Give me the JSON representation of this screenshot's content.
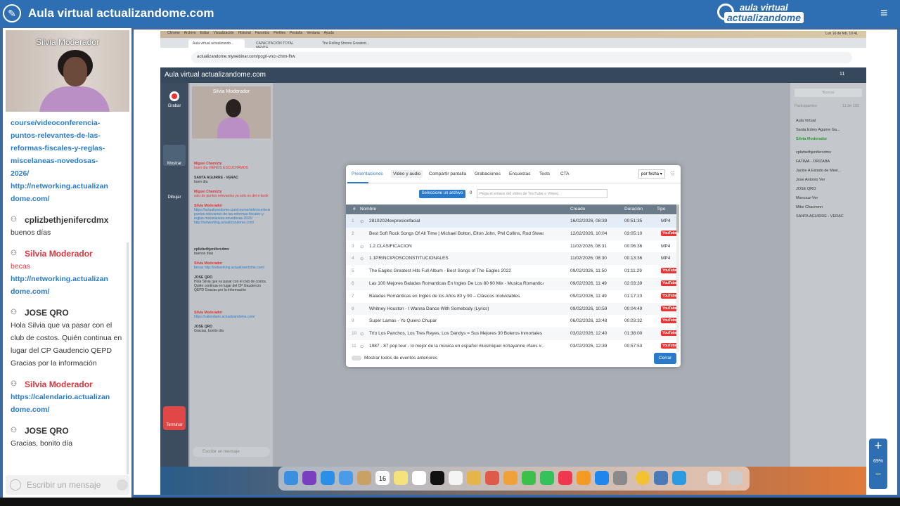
{
  "app": {
    "title": "Aula virtual actualizandome.com",
    "logo_top": "aula virtual",
    "logo_bottom": "actualizandome",
    "menu_icon": "≡"
  },
  "left_video": {
    "name": "Silvia Moderador"
  },
  "left_chat": {
    "link1_lines": [
      "course/videoconferencia-",
      "puntos-relevantes-de-las-",
      "reformas-fiscales-y-reglas-",
      "miscelaneas-novedosas-",
      "2026/"
    ],
    "link2_lines": [
      "http://networking.actualizan",
      "dome.com/"
    ],
    "messages": [
      {
        "author": "cplizbethjenifercdmx",
        "lines": [
          "buenos días"
        ],
        "color": "dark"
      },
      {
        "author": "Silvia Moderador",
        "lines": [
          "becas"
        ],
        "links": [
          "http://networking.actualizan",
          "dome.com/"
        ],
        "color": "red"
      },
      {
        "author": "JOSE QRO",
        "lines": [
          "Hola Silvia que va pasar con el",
          "club de costos. Quién continua en",
          "lugar del CP Gaudencio QEPD",
          "Gracias por la información"
        ],
        "color": "dark"
      },
      {
        "author": "Silvia Moderador",
        "lines": [],
        "links": [
          "https://calendario.actualizan",
          "dome.com/"
        ],
        "color": "red"
      },
      {
        "author": "JOSE QRO",
        "lines": [
          "Gracias, bonito día"
        ],
        "color": "dark"
      }
    ],
    "input_placeholder": "Escribir un mensaje"
  },
  "shared_screen": {
    "mac_menu": [
      "Chrome",
      "Archivo",
      "Editar",
      "Visualización",
      "Historial",
      "Favoritos",
      "Perfiles",
      "Pestaña",
      "Ventana",
      "Ayuda"
    ],
    "mac_status": "Lun 16 de feb. 10:41",
    "tabs": [
      "Aula virtual actualizando...",
      "CAPACITACIÓN TOTAL MENTE...",
      "The Rolling Stones Greatest..."
    ],
    "url": "actualizandome.mywebinar.com/pcgri-vncr-zhtm-fhw",
    "app_title": "Aula virtual actualizandome.com",
    "left_tools": [
      "Grabar",
      "Mostrar",
      "Dibujar",
      "Terminar"
    ],
    "mini_video_name": "Silvia Moderador",
    "mini_chat": [
      {
        "author": "Miguel Chamizty",
        "text": "buen día\nVIENOS ESCUCHAMOS",
        "color": "red"
      },
      {
        "author": "SANTA AGUIRRE - VERAC",
        "text": "buen día",
        "color": "dark"
      },
      {
        "author": "Miguel Chamizty",
        "text": "solo de puntos relevantes ya solo es del\ne-book",
        "color": "red"
      },
      {
        "author": "Silvia Moderador",
        "text": "https://actualizandome.com/course/videoconferencia-puntos-relevantes-de-las-reformas-fiscales-y-reglas-miscelaneas-novedosas-2026/\nhttp://networking.actualizandome.com/",
        "color": "blue"
      },
      {
        "author": "cplizbethjenifercdmx",
        "text": "buenos días",
        "color": "dark"
      },
      {
        "author": "Silvia Moderador",
        "text": "becas\nhttp://networking.actualizandome.com/",
        "color": "blue"
      },
      {
        "author": "JOSE QRO",
        "text": "Hola Silvia que va pasar con el club de costos. Quién continua en lugar del CP Gaudencio QEPD\nGracias por la información",
        "color": "dark"
      },
      {
        "author": "Silvia Moderador",
        "text": "https://calendario.actualizandome.com/",
        "color": "blue"
      },
      {
        "author": "JOSE QRO",
        "text": "Gracias, bonito día",
        "color": "dark"
      }
    ],
    "mini_input": "Escribir un mensaje",
    "participants": {
      "search": "Buscar",
      "label": "Participantes",
      "count": "11 de 100",
      "items": [
        "Aula Virtual",
        "Santa Edrey Aguirre Ga...",
        "Silvia Moderador",
        "cplizbethjenifercdmx",
        "FATIMA - ORIZABA",
        "Jackie A Estado de Mexi...",
        "Jose Antonio Ver",
        "JOSE QRO",
        "Mancruz-Ver",
        "Mike Chacmmn",
        "SANTA AGUIRRE - VERAC"
      ]
    },
    "header_count": "11"
  },
  "modal": {
    "tabs": [
      "Presentaciones",
      "Video y audio",
      "Compartir pantalla",
      "Grabaciones",
      "Encuestas",
      "Tests",
      "CTA"
    ],
    "sort": "por fecha",
    "select_button": "Seleccione un archivo",
    "zero": "0",
    "url_placeholder": "Pega el enlace del video de YouTube o Vimeo",
    "columns": [
      "#",
      "Nombre",
      "Creado",
      "Duración",
      "Tipo"
    ],
    "rows": [
      {
        "n": "1",
        "name": "28102024expresionfacial",
        "created": "16/02/2026, 08:39",
        "duration": "00:51:35",
        "type": "MP4"
      },
      {
        "n": "2",
        "name": "Best Soft Rock Songs Of All Time | Michael Bolton, Elton John, Phil Collins, Rod Stewart...",
        "created": "12/02/2026, 10:04",
        "duration": "03:05:10",
        "type": "YouTube"
      },
      {
        "n": "3",
        "name": "1.2.CLASIFICACION",
        "created": "11/02/2026, 08:31",
        "duration": "00:06:36",
        "type": "MP4"
      },
      {
        "n": "4",
        "name": "1.1PRINCIPIOSCONSTITUCIONALES",
        "created": "11/02/2026, 08:30",
        "duration": "00:13:36",
        "type": "MP4"
      },
      {
        "n": "5",
        "name": "The Eagles Greatest Hits Full Album - Best Songs of The Eagles 2022",
        "created": "09/02/2026, 11:50",
        "duration": "01:11:29",
        "type": "YouTube"
      },
      {
        "n": "6",
        "name": "Las 100 Mejores Baladas Romanticas En Ingles De Los 80 90 Mix - Musica Romantica D...",
        "created": "09/02/2026, 11:49",
        "duration": "02:03:39",
        "type": "YouTube"
      },
      {
        "n": "7",
        "name": "Baladas Románticas en Inglés de los Años 80 y 90 – Clásicos Inolvidables",
        "created": "09/02/2026, 11:49",
        "duration": "01:17:23",
        "type": "YouTube"
      },
      {
        "n": "8",
        "name": "Whitney Houston - I Wanna Dance With Somebody (Lyrics)",
        "created": "09/02/2026, 10:59",
        "duration": "00:04:49",
        "type": "YouTube"
      },
      {
        "n": "9",
        "name": "Super Lamas - Yo Quiero Chupar",
        "created": "06/02/2026, 13:48",
        "duration": "00:03:32",
        "type": "YouTube"
      },
      {
        "n": "10",
        "name": "Trío Los Panchos, Los Tres Reyes, Los Dandys = Sus Mejores 30 Boleros Inmortales",
        "created": "03/02/2026, 12:40",
        "duration": "01:38:00",
        "type": "YouTube"
      },
      {
        "n": "11",
        "name": "1987 - 87 pop tour - lo mejor de la música en español #luismiquel #chayanne #fans #...",
        "created": "03/02/2026, 12:39",
        "duration": "00:57:53",
        "type": "YouTube"
      }
    ],
    "show_prev": "Mostrar todos de eventos anteriores",
    "close": "Cerrar"
  },
  "dock_date": "16",
  "zoom_pct": "69%"
}
